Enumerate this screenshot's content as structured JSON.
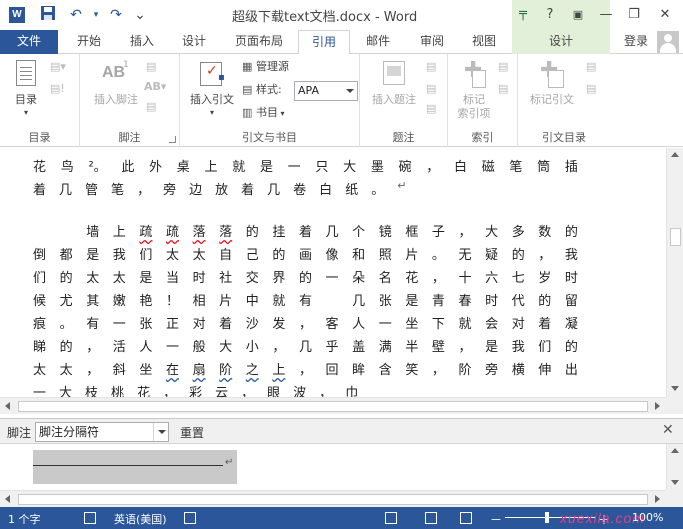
{
  "window": {
    "title": "超级下载text文档.docx - Word",
    "controls": {
      "help": "?",
      "ribbon_display": "▣",
      "minimize": "—",
      "restore": "❐",
      "close": "✕"
    }
  },
  "qat": {
    "undo": "↶",
    "redo": "↷",
    "more": "⌄"
  },
  "tabs": [
    {
      "label": "文件"
    },
    {
      "label": "开始"
    },
    {
      "label": "插入"
    },
    {
      "label": "设计"
    },
    {
      "label": "页面布局"
    },
    {
      "label": "引用"
    },
    {
      "label": "邮件"
    },
    {
      "label": "审阅"
    },
    {
      "label": "视图"
    },
    {
      "label": "设计"
    }
  ],
  "account": {
    "login": "登录"
  },
  "ribbon": {
    "groups": {
      "toc": "目录",
      "footnotes": "脚注",
      "citations": "引文与书目",
      "captions": "题注",
      "index": "索引",
      "toa": "引文目录"
    },
    "buttons": {
      "toc": "目录",
      "insert_footnote": "插入脚注",
      "insert_citation": "插入引文",
      "manage_sources": "管理源",
      "style_label": "样式:",
      "style_value": "APA",
      "bibliography": "书目",
      "insert_caption": "插入题注",
      "mark_entry_1": "标记",
      "mark_entry_2": "索引项",
      "mark_citation": "标记引文",
      "ab_icon": "AB",
      "ab_super": "1"
    }
  },
  "document": {
    "lines": [
      [
        "花",
        "鸟",
        "²。",
        "此",
        "外",
        "桌",
        "上",
        "就",
        "是",
        "一",
        "只",
        "大",
        "墨",
        "碗",
        "，",
        "白",
        "磁",
        "笔",
        "筒",
        "插"
      ],
      [
        "着",
        "几",
        "管",
        "笔",
        "，",
        "旁",
        "边",
        "放",
        "着",
        "几",
        "卷",
        "白",
        "纸",
        "。",
        "↵"
      ],
      [],
      [
        "　",
        "　",
        "墙",
        "上",
        "疏",
        "疏",
        "落",
        "落",
        "的",
        "挂",
        "着",
        "几",
        "个",
        "镜",
        "框",
        "子",
        "，",
        "大",
        "多",
        "数",
        "的"
      ],
      [
        "倒",
        "都",
        "是",
        "我",
        "们",
        "太",
        "太",
        "自",
        "己",
        "的",
        "画",
        "像",
        "和",
        "照",
        "片",
        "。",
        "无",
        "疑",
        "的",
        "，",
        "我"
      ],
      [
        "们",
        "的",
        "太",
        "太",
        "是",
        "当",
        "时",
        "社",
        "交",
        "界",
        "的",
        "一",
        "朵",
        "名",
        "花",
        "，",
        "十",
        "六",
        "七",
        "岁",
        "时"
      ],
      [
        "候",
        "尤",
        "其",
        "嫩",
        "艳",
        "！",
        "相",
        "片",
        "中",
        "就",
        "有",
        "　",
        "几",
        "张",
        "是",
        "青",
        "春",
        "时",
        "代",
        "的",
        "留"
      ],
      [
        "痕",
        "。",
        "有",
        "一",
        "张",
        "正",
        "对",
        "着",
        "沙",
        "发",
        "，",
        "客",
        "人",
        "一",
        "坐",
        "下",
        "就",
        "会",
        "对",
        "着",
        "凝"
      ],
      [
        "睇",
        "的",
        "，",
        "活",
        "人",
        "一",
        "般",
        "大",
        "小",
        "，",
        "几",
        "乎",
        "盖",
        "满",
        "半",
        "壁",
        "，",
        "是",
        "我",
        "们",
        "的"
      ],
      [
        "太",
        "太",
        "，",
        "斜",
        "坐",
        "在",
        "扇",
        "阶",
        "之",
        "上",
        "，",
        "回",
        "眸",
        "含",
        "笑",
        "，",
        "阶",
        "旁",
        "横",
        "伸",
        "出"
      ],
      [
        "一",
        "大",
        "枝",
        "桃",
        "花",
        "，",
        "彩",
        "云",
        "，",
        "眼",
        "波",
        "，",
        "巾"
      ]
    ]
  },
  "footnote_pane": {
    "label": "脚注",
    "selector_value": "脚注分隔符",
    "reset": "重置",
    "close": "✕",
    "separator_mark": "↵"
  },
  "statusbar": {
    "page_count": "1 个字",
    "language": "英语(美国)",
    "zoom": "100%",
    "minus": "－",
    "plus": "＋"
  },
  "watermark": "xuexila.com"
}
